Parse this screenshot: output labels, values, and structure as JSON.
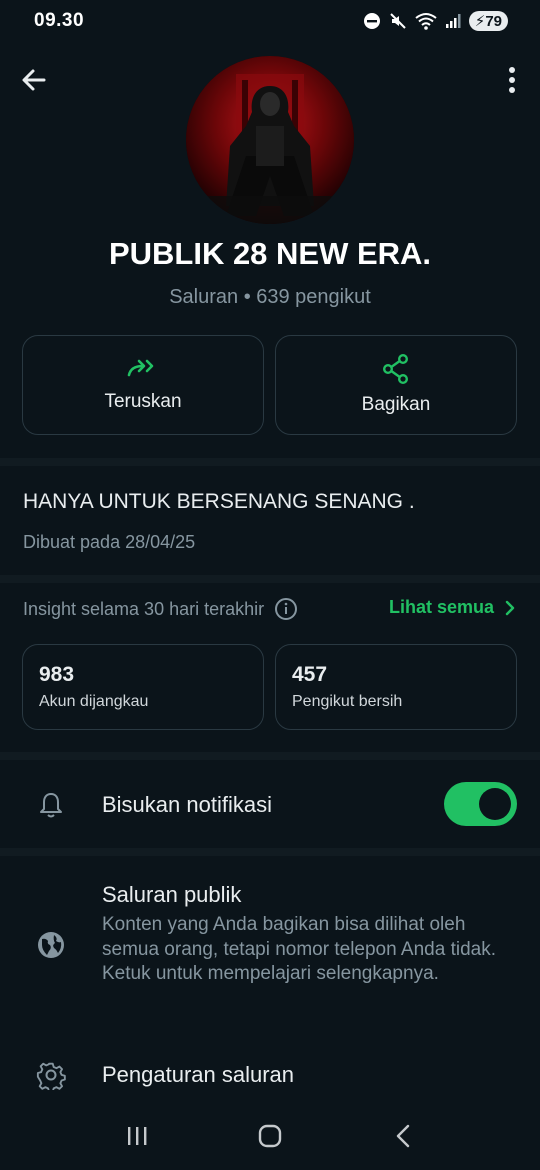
{
  "status_bar": {
    "time": "09.30",
    "battery": "79"
  },
  "channel": {
    "name": "PUBLIK 28 NEW ERA.",
    "subtitle": "Saluran • 639 pengikut"
  },
  "actions": {
    "forward_label": "Teruskan",
    "share_label": "Bagikan"
  },
  "description": {
    "text": "HANYA UNTUK BERSENANG SENANG .",
    "created": "Dibuat pada 28/04/25"
  },
  "insights": {
    "label": "Insight selama 30 hari terakhir",
    "see_all": "Lihat semua",
    "stats": [
      {
        "value": "983",
        "label": "Akun dijangkau"
      },
      {
        "value": "457",
        "label": "Pengikut bersih"
      }
    ]
  },
  "settings": {
    "mute_label": "Bisukan notifikasi",
    "mute_enabled": true,
    "public_title": "Saluran publik",
    "public_desc": "Konten yang Anda bagikan bisa dilihat oleh semua orang, tetapi nomor telepon Anda tidak. Ketuk untuk mempelajari selengkapnya.",
    "channel_settings_label": "Pengaturan saluran"
  },
  "colors": {
    "accent": "#21c063",
    "background": "#0b141a",
    "secondary_text": "#8696a0"
  },
  "icons": {
    "back": "arrow-left-icon",
    "menu": "more-vert-icon",
    "forward": "double-forward-icon",
    "share": "share-icon",
    "info": "info-icon",
    "chevron": "chevron-right-icon",
    "bell": "bell-icon",
    "globe": "globe-icon",
    "gear": "gear-icon"
  }
}
